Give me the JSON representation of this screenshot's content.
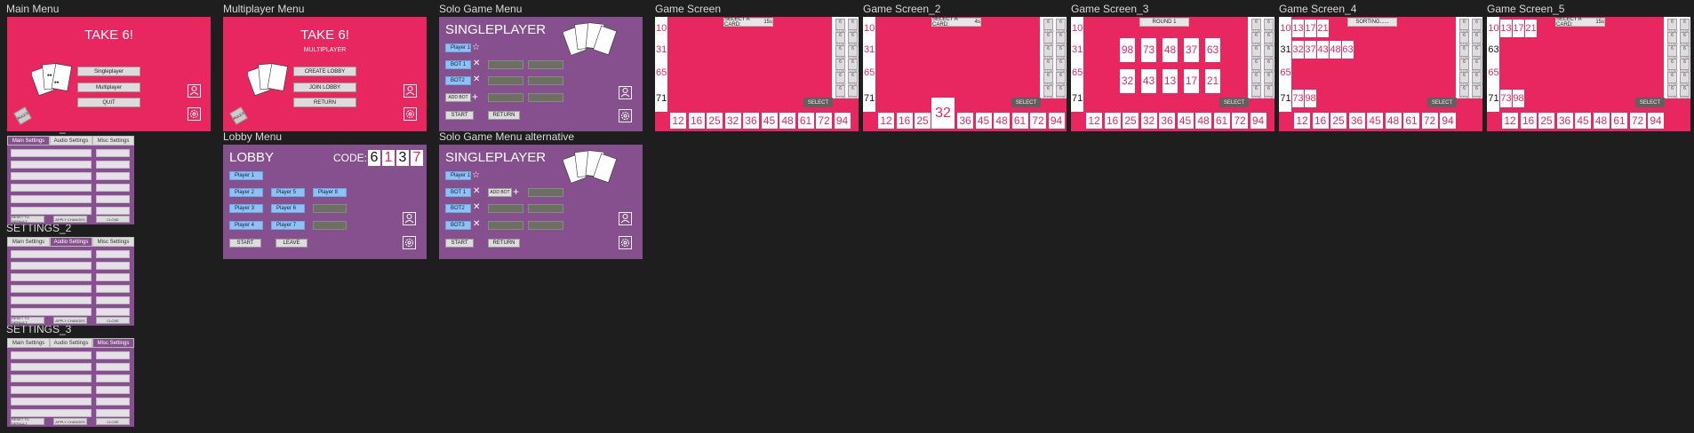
{
  "frames": {
    "main_menu": "Main Menu",
    "multiplayer_menu": "Multiplayer Menu",
    "solo_menu": "Solo Game Menu",
    "game_screen": "Game Screen",
    "game_screen_2": "Game Screen_2",
    "game_screen_3": "Game Screen_3",
    "game_screen_4": "Game Screen_4",
    "game_screen_5": "Game Screen_5",
    "settings_1": "SETTINGS_1",
    "settings_2": "SETTINGS_2",
    "settings_3": "SETTINGS_3",
    "lobby_menu": "Lobby Menu",
    "solo_menu_alt": "Solo Game Menu alternative"
  },
  "main_menu": {
    "title": "TAKE 6!",
    "singleplayer": "Singleplayer",
    "multiplayer": "Multiplayer",
    "quit": "QUIT",
    "rules": "RULES"
  },
  "multi_menu": {
    "title": "TAKE 6!",
    "subtitle": "MULTIPLAYER",
    "create": "CREATE LOBBY",
    "join": "JOIN LOBBY",
    "return": "RETURN",
    "rules": "RULES"
  },
  "solo_menu": {
    "title": "SINGLEPLAYER",
    "player1": "Player 1",
    "bot1": "BOT 1",
    "bot2": "BOT2",
    "add_bot": "ADD BOT",
    "start": "START",
    "return": "RETURN"
  },
  "solo_alt": {
    "title": "SINGLEPLAYER",
    "player1": "Player 1",
    "bot1": "BOT 1",
    "add_bot": "ADD BOT",
    "bot2": "BOT2",
    "bot3": "BOT3",
    "start": "START",
    "return": "RETURN"
  },
  "lobby": {
    "title": "LOBBY",
    "code_label": "CODE:",
    "code": [
      "6",
      "1",
      "3",
      "7"
    ],
    "players": [
      "Player 1",
      "Player 2",
      "Player 5",
      "Player 8",
      "Player 3",
      "Player 6",
      "Player 4",
      "Player 7"
    ],
    "start": "START",
    "leave": "LEAVE"
  },
  "settings": {
    "tabs": [
      "Main Settings",
      "Audio Settings",
      "Misc Settings"
    ],
    "reset": "RESET TO DEFAULT",
    "apply": "APPLY CHANGES",
    "close": "CLOSE"
  },
  "game": {
    "select_a_card": "SELECT A CARD:",
    "timer_1": "15s",
    "timer_2": "4s",
    "timer_5": "15s",
    "round": "ROUND 1",
    "sorting": "SORTING......",
    "select_btn": "SELECT",
    "rows": [
      "10",
      "31",
      "65",
      "71"
    ],
    "hand": [
      "12",
      "16",
      "25",
      "32",
      "36",
      "45",
      "48",
      "61",
      "72",
      "94"
    ],
    "hand_2": [
      "12",
      "16",
      "25",
      "36",
      "45",
      "48",
      "61",
      "72",
      "94"
    ],
    "picked_2": "32",
    "reveal_3": [
      [
        "98",
        "73",
        "48",
        "37",
        "63"
      ],
      [
        "32",
        "43",
        "13",
        "17",
        "21"
      ]
    ],
    "rows_4": [
      [
        "10",
        "13",
        "17",
        "21"
      ],
      [
        "31",
        "32",
        "37",
        "43",
        "48",
        "63"
      ],
      [
        "65"
      ],
      [
        "71",
        "73",
        "98"
      ]
    ],
    "rows_5": [
      [
        "10",
        "13",
        "17",
        "21"
      ],
      [
        "63"
      ],
      [
        "65"
      ],
      [
        "71",
        "73",
        "98"
      ]
    ],
    "hand_4": [
      "12",
      "16",
      "25",
      "36",
      "45",
      "48",
      "61",
      "72",
      "94"
    ],
    "player_label": "PLAYER"
  }
}
